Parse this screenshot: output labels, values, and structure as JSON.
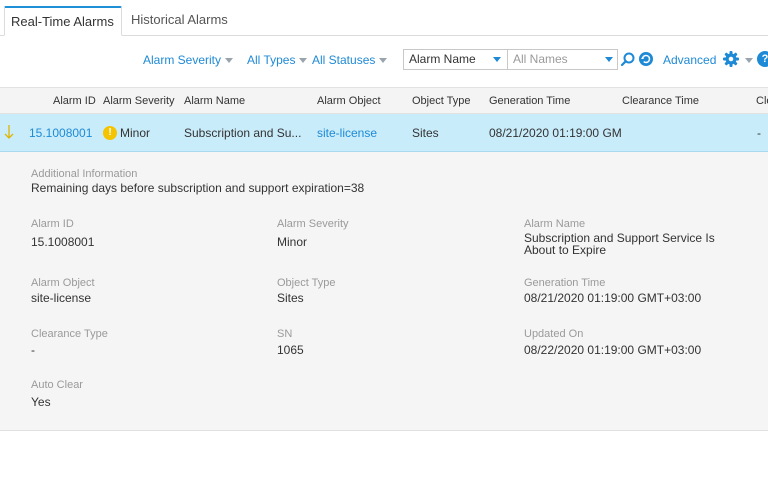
{
  "tabs": [
    {
      "label": "Real-Time Alarms",
      "active": true
    },
    {
      "label": "Historical Alarms",
      "active": false
    }
  ],
  "filters": {
    "severity": "Alarm Severity",
    "types": "All Types",
    "statuses": "All Statuses",
    "name_field": "Alarm Name",
    "name_placeholder": "All Names",
    "advanced": "Advanced"
  },
  "table": {
    "columns": [
      "Alarm ID",
      "Alarm Severity",
      "Alarm Name",
      "Alarm Object",
      "Object Type",
      "Generation Time",
      "Clearance Time",
      "Cle"
    ],
    "row": {
      "alarm_id": "15.1008001",
      "severity": "Minor",
      "name": "Subscription and Su...",
      "object": "site-license",
      "object_type": "Sites",
      "generation_time": "08/21/2020 01:19:00 GM",
      "clearance": "-"
    }
  },
  "details": {
    "additional_label": "Additional Information",
    "additional_value": "Remaining days before subscription and support expiration=38",
    "fields": [
      {
        "label": "Alarm ID",
        "value": "15.1008001"
      },
      {
        "label": "Alarm Severity",
        "value": "Minor"
      },
      {
        "label": "Alarm Name",
        "value": "Subscription and Support Service Is About to Expire"
      },
      {
        "label": "Alarm Object",
        "value": "site-license"
      },
      {
        "label": "Object Type",
        "value": "Sites"
      },
      {
        "label": "Generation Time",
        "value": "08/21/2020 01:19:00 GMT+03:00"
      },
      {
        "label": "Clearance Type",
        "value": "-"
      },
      {
        "label": "SN",
        "value": "1065"
      },
      {
        "label": "Updated On",
        "value": "08/22/2020 01:19:00 GMT+03:00"
      },
      {
        "label": "Auto Clear",
        "value": "Yes"
      }
    ]
  },
  "colors": {
    "accent": "#1e8ad6",
    "selected_row": "#c9ecfa",
    "minor": "#f5c400"
  }
}
